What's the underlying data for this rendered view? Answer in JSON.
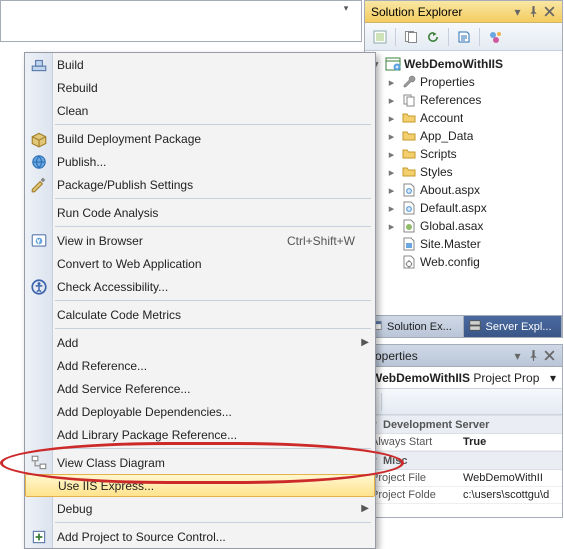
{
  "panels": {
    "solution": {
      "title": "Solution Explorer",
      "tabs": {
        "left": "Solution Ex...",
        "right": "Server Expl..."
      }
    },
    "properties": {
      "title": "roperties",
      "combo_name": "WebDemoWithIIS",
      "combo_type": "Project Prop",
      "categories": {
        "dev": "Development Server",
        "misc": "Misc"
      },
      "rows": {
        "always_start_key": "Always Start",
        "always_start_val": "True",
        "project_file_key": "Project File",
        "project_file_val": "WebDemoWithII",
        "project_folder_key": "Project Folde",
        "project_folder_val": "c:\\users\\scottgu\\d"
      }
    }
  },
  "tree": {
    "root": "WebDemoWithIIS",
    "items": [
      {
        "label": "Properties",
        "icon": "wrench"
      },
      {
        "label": "References",
        "icon": "refs"
      },
      {
        "label": "Account",
        "icon": "folder"
      },
      {
        "label": "App_Data",
        "icon": "folder"
      },
      {
        "label": "Scripts",
        "icon": "folder"
      },
      {
        "label": "Styles",
        "icon": "folder"
      },
      {
        "label": "About.aspx",
        "icon": "aspx"
      },
      {
        "label": "Default.aspx",
        "icon": "aspx"
      },
      {
        "label": "Global.asax",
        "icon": "asax"
      },
      {
        "label": "Site.Master",
        "icon": "master"
      },
      {
        "label": "Web.config",
        "icon": "config"
      }
    ]
  },
  "menu": {
    "build": "Build",
    "rebuild": "Rebuild",
    "clean": "Clean",
    "build_deploy": "Build Deployment Package",
    "publish": "Publish...",
    "pkg_pub_settings": "Package/Publish Settings",
    "run_code_analysis": "Run Code Analysis",
    "view_in_browser": "View in Browser",
    "view_in_browser_shortcut": "Ctrl+Shift+W",
    "convert_webapp": "Convert to Web Application",
    "check_accessibility": "Check Accessibility...",
    "calc_metrics": "Calculate Code Metrics",
    "add": "Add",
    "add_reference": "Add Reference...",
    "add_service_reference": "Add Service Reference...",
    "add_deployable": "Add Deployable Dependencies...",
    "add_library_pkg": "Add Library Package Reference...",
    "view_class_diagram": "View Class Diagram",
    "use_iis_express": "Use IIS Express...",
    "debug": "Debug",
    "add_project_to_scc": "Add Project to Source Control..."
  }
}
